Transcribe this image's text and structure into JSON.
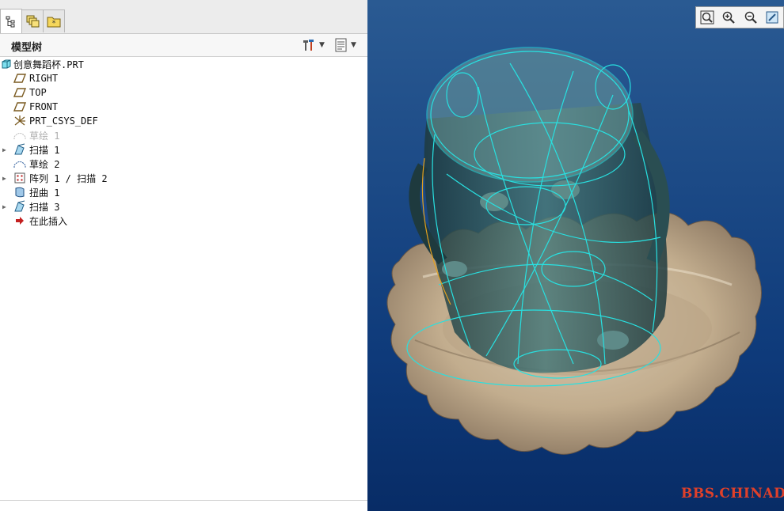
{
  "tabs": [
    {
      "name": "model-tree-tab",
      "icon": "tree-icon",
      "active": true
    },
    {
      "name": "layers-tab",
      "icon": "layers-icon",
      "active": false
    },
    {
      "name": "favorites-tab",
      "icon": "folder-star-icon",
      "active": false
    }
  ],
  "model_tree": {
    "title": "模型树",
    "items": [
      {
        "label": "创意舞蹈杯.PRT",
        "icon": "part-icon",
        "expandable": false
      },
      {
        "label": "RIGHT",
        "icon": "datum-plane-icon",
        "expandable": false
      },
      {
        "label": "TOP",
        "icon": "datum-plane-icon",
        "expandable": false
      },
      {
        "label": "FRONT",
        "icon": "datum-plane-icon",
        "expandable": false
      },
      {
        "label": "PRT_CSYS_DEF",
        "icon": "csys-icon",
        "expandable": false
      },
      {
        "label": "草绘 1",
        "icon": "sketch-icon",
        "expandable": false,
        "disabled": true
      },
      {
        "label": "扫描 1",
        "icon": "sweep-icon",
        "expandable": true
      },
      {
        "label": "草绘 2",
        "icon": "sketch-icon",
        "expandable": false
      },
      {
        "label": "阵列 1 / 扫描 2",
        "icon": "pattern-icon",
        "expandable": true
      },
      {
        "label": "扭曲 1",
        "icon": "warp-icon",
        "expandable": false
      },
      {
        "label": "扫描 3",
        "icon": "sweep-icon",
        "expandable": true
      },
      {
        "label": "在此插入",
        "icon": "insert-arrow-icon",
        "expandable": false
      }
    ]
  },
  "view_toolbar": [
    "zoom-fit-icon",
    "zoom-in-icon",
    "zoom-out-icon",
    "repaint-icon"
  ],
  "watermark": "BBS.CHINADE.NET",
  "colors": {
    "viewport_top": "#2a5a92",
    "viewport_bottom": "#082c66",
    "edge_highlight": "#28e0e0",
    "model_dark": "#2a4e52",
    "plate": "#c9b89e",
    "watermark": "#e0402a"
  }
}
